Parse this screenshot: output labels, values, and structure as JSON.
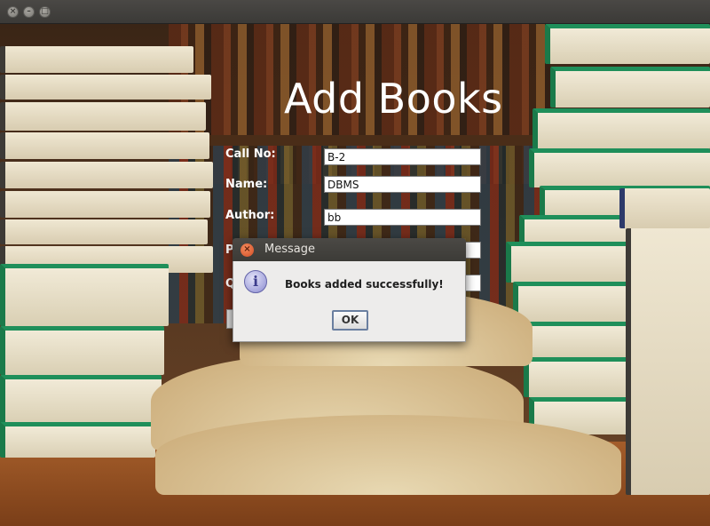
{
  "window": {
    "controls": [
      "close-icon",
      "minimize-icon",
      "maximize-icon"
    ]
  },
  "form": {
    "heading": "Add Books",
    "fields": [
      {
        "label": "Call No:",
        "value": "B-2"
      },
      {
        "label": "Name:",
        "value": "DBMS"
      },
      {
        "label": "Author:",
        "value": "bb"
      },
      {
        "label": "P",
        "value": ""
      },
      {
        "label": "Q",
        "value": ""
      }
    ]
  },
  "dialog": {
    "title": "Message",
    "icon": "info-icon",
    "message": "Books added successfully!",
    "ok_label": "OK"
  }
}
